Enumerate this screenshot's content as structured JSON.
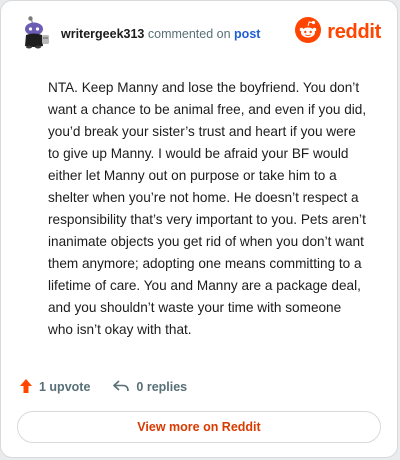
{
  "header": {
    "username": "writergeek313",
    "action_text": "commented on",
    "post_link": "post"
  },
  "brand": {
    "logo_text": "reddit",
    "accent_color": "#ff4500"
  },
  "comment": {
    "body": "NTA. Keep Manny and lose the boyfriend. You don’t want a chance to be animal free, and even if you did, you’d break your sister’s trust and heart if you were to give up Manny. I would be afraid your BF would either let Manny out on purpose or take him to a shelter when you’re not home. He doesn’t respect a responsibility that’s very important to you. Pets aren’t inanimate objects you get rid of when you don’t want them anymore; adopting one means committing to a lifetime of care. You and Manny are a package deal, and you shouldn’t waste your time with someone who isn’t okay with that."
  },
  "actions": {
    "upvote_label": "1 upvote",
    "replies_label": "0 replies"
  },
  "footer": {
    "view_more_label": "View more on Reddit"
  },
  "icons": {
    "avatar": "snoo-avatar-icon",
    "logo": "reddit-alien-icon",
    "upvote": "upvote-arrow-icon",
    "reply": "reply-arrow-icon"
  }
}
